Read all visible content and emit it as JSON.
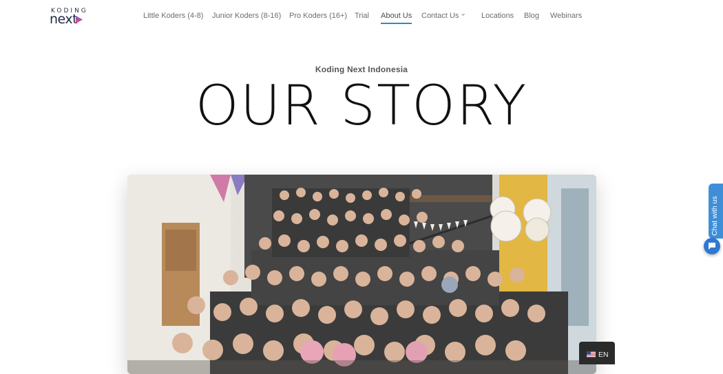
{
  "brand": {
    "logo_top": "KODING",
    "logo_bottom": "next"
  },
  "nav": {
    "items": [
      {
        "label": "Little Koders (4-8)"
      },
      {
        "label": "Junior Koders (8-16)"
      },
      {
        "label": "Pro Koders (16+)"
      },
      {
        "label": "Trial"
      },
      {
        "label": "About Us"
      },
      {
        "label": "Contact Us"
      },
      {
        "label": "Locations"
      },
      {
        "label": "Blog"
      },
      {
        "label": "Webinars"
      }
    ],
    "active": "About Us",
    "accent_color": "#2e87c6"
  },
  "hero": {
    "eyebrow": "Koding Next Indonesia",
    "title": "OUR STORY"
  },
  "photo": {
    "subject": "team-group-photo"
  },
  "chat": {
    "label": "Chat with us",
    "color": "#3f8fd8"
  },
  "language": {
    "code": "EN",
    "flag": "us-flag-icon"
  }
}
